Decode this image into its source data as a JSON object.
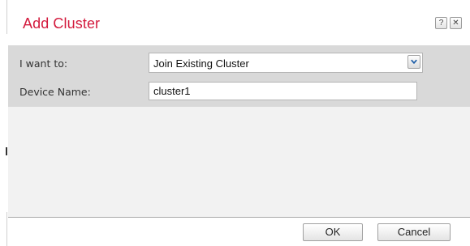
{
  "dialog": {
    "title": "Add Cluster",
    "help_icon": "question-icon",
    "help_glyph": "?",
    "close_icon": "close-icon",
    "close_glyph": "✕"
  },
  "form": {
    "action_label": "I want to:",
    "action_value": "Join Existing Cluster",
    "device_name_label": "Device Name:",
    "device_name_value": "cluster1"
  },
  "footer": {
    "ok_label": "OK",
    "cancel_label": "Cancel"
  },
  "colors": {
    "title": "#d31a3d",
    "form_background": "#d9d9d9",
    "body_background": "#f2f2f2",
    "dropdown_arrow": "#1f5fa8"
  }
}
